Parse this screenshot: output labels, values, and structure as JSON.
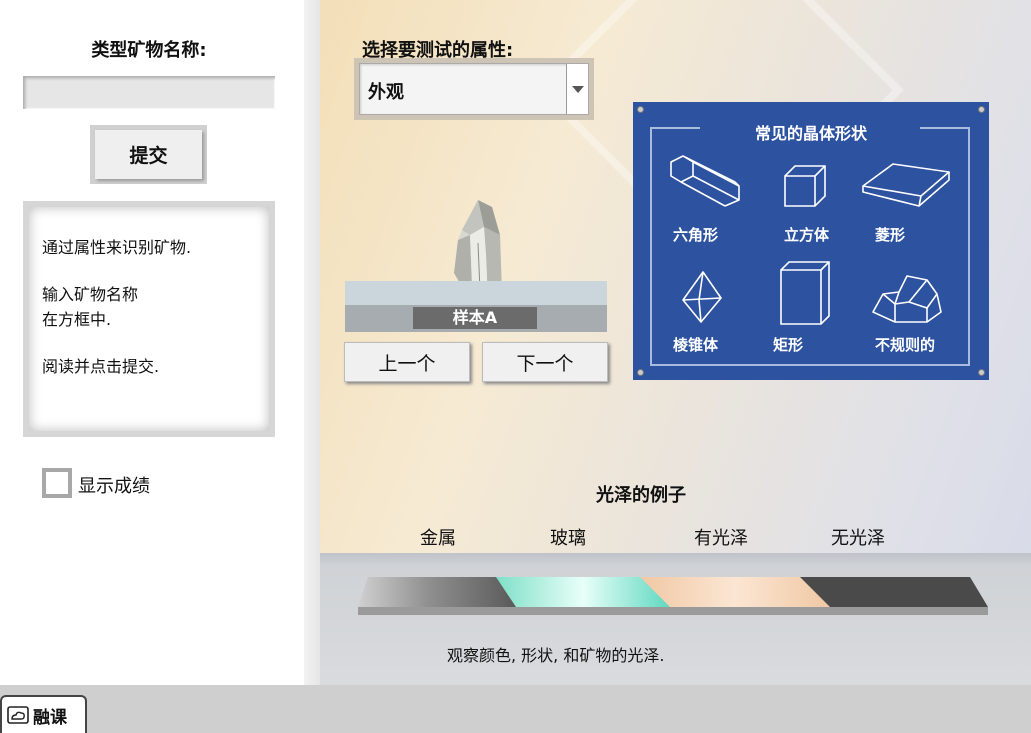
{
  "left_panel": {
    "title": "类型矿物名称:",
    "name_input_value": "",
    "submit_label": "提交",
    "instructions": [
      "通过属性来识别矿物.",
      "输入矿物名称\n在方框中.",
      "阅读并点击提交."
    ],
    "show_score_label": "显示成绩"
  },
  "property_select": {
    "label": "选择要测试的属性:",
    "selected": "外观"
  },
  "sample": {
    "label": "样本A",
    "prev_label": "上一个",
    "next_label": "下一个"
  },
  "poster": {
    "title": "常见的晶体形状",
    "shapes": [
      "六角形",
      "立方体",
      "菱形",
      "棱锥体",
      "矩形",
      "不规则的"
    ]
  },
  "luster": {
    "title": "光泽的例子",
    "labels": [
      "金属",
      "玻璃",
      "有光泽",
      "无光泽"
    ],
    "colors": {
      "metal": "#8f8f8f",
      "glass": "#7fe0c8",
      "shiny": "#f0c8a4",
      "dull": "#4a4a4a"
    },
    "caption": "观察颜色, 形状, 和矿物的光泽."
  },
  "footer": {
    "logo_text": "融课"
  }
}
